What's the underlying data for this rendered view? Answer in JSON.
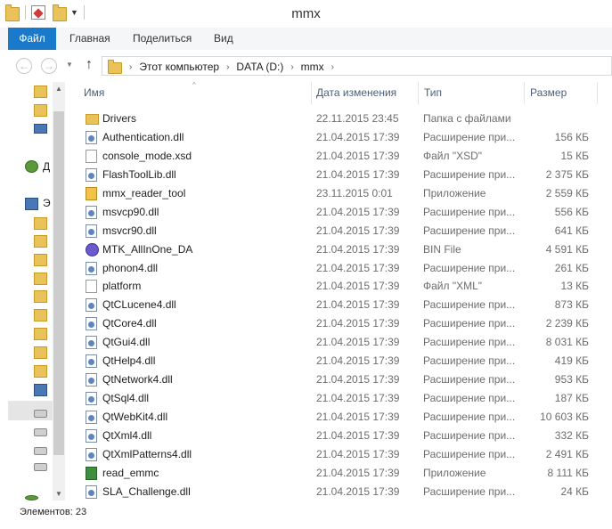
{
  "window": {
    "title": "mmx"
  },
  "ribbon": {
    "tabs": [
      "Файл",
      "Главная",
      "Поделиться",
      "Вид"
    ]
  },
  "address": {
    "crumbs": [
      "Этот компьютер",
      "DATA (D:)",
      "mmx"
    ]
  },
  "nav_pane": {
    "partial_labels": [
      "Д",
      "Э"
    ]
  },
  "columns": {
    "name": "Имя",
    "date": "Дата изменения",
    "type": "Тип",
    "size": "Размер"
  },
  "files": [
    {
      "name": "Drivers",
      "date": "22.11.2015 23:45",
      "type": "Папка с файлами",
      "size": "",
      "icon": "folder"
    },
    {
      "name": "Authentication.dll",
      "date": "21.04.2015 17:39",
      "type": "Расширение при...",
      "size": "156 КБ",
      "icon": "dll"
    },
    {
      "name": "console_mode.xsd",
      "date": "21.04.2015 17:39",
      "type": "Файл \"XSD\"",
      "size": "15 КБ",
      "icon": "doc"
    },
    {
      "name": "FlashToolLib.dll",
      "date": "21.04.2015 17:39",
      "type": "Расширение при...",
      "size": "2 375 КБ",
      "icon": "dll"
    },
    {
      "name": "mmx_reader_tool",
      "date": "23.11.2015 0:01",
      "type": "Приложение",
      "size": "2 559 КБ",
      "icon": "exe1"
    },
    {
      "name": "msvcp90.dll",
      "date": "21.04.2015 17:39",
      "type": "Расширение при...",
      "size": "556 КБ",
      "icon": "dll"
    },
    {
      "name": "msvcr90.dll",
      "date": "21.04.2015 17:39",
      "type": "Расширение при...",
      "size": "641 КБ",
      "icon": "dll"
    },
    {
      "name": "MTK_AllInOne_DA",
      "date": "21.04.2015 17:39",
      "type": "BIN File",
      "size": "4 591 КБ",
      "icon": "bin"
    },
    {
      "name": "phonon4.dll",
      "date": "21.04.2015 17:39",
      "type": "Расширение при...",
      "size": "261 КБ",
      "icon": "dll"
    },
    {
      "name": "platform",
      "date": "21.04.2015 17:39",
      "type": "Файл \"XML\"",
      "size": "13 КБ",
      "icon": "doc"
    },
    {
      "name": "QtCLucene4.dll",
      "date": "21.04.2015 17:39",
      "type": "Расширение при...",
      "size": "873 КБ",
      "icon": "dll"
    },
    {
      "name": "QtCore4.dll",
      "date": "21.04.2015 17:39",
      "type": "Расширение при...",
      "size": "2 239 КБ",
      "icon": "dll"
    },
    {
      "name": "QtGui4.dll",
      "date": "21.04.2015 17:39",
      "type": "Расширение при...",
      "size": "8 031 КБ",
      "icon": "dll"
    },
    {
      "name": "QtHelp4.dll",
      "date": "21.04.2015 17:39",
      "type": "Расширение при...",
      "size": "419 КБ",
      "icon": "dll"
    },
    {
      "name": "QtNetwork4.dll",
      "date": "21.04.2015 17:39",
      "type": "Расширение при...",
      "size": "953 КБ",
      "icon": "dll"
    },
    {
      "name": "QtSql4.dll",
      "date": "21.04.2015 17:39",
      "type": "Расширение при...",
      "size": "187 КБ",
      "icon": "dll"
    },
    {
      "name": "QtWebKit4.dll",
      "date": "21.04.2015 17:39",
      "type": "Расширение при...",
      "size": "10 603 КБ",
      "icon": "dll"
    },
    {
      "name": "QtXml4.dll",
      "date": "21.04.2015 17:39",
      "type": "Расширение при...",
      "size": "332 КБ",
      "icon": "dll"
    },
    {
      "name": "QtXmlPatterns4.dll",
      "date": "21.04.2015 17:39",
      "type": "Расширение при...",
      "size": "2 491 КБ",
      "icon": "dll"
    },
    {
      "name": "read_emmc",
      "date": "21.04.2015 17:39",
      "type": "Приложение",
      "size": "8 111 КБ",
      "icon": "exe2"
    },
    {
      "name": "SLA_Challenge.dll",
      "date": "21.04.2015 17:39",
      "type": "Расширение при...",
      "size": "24 КБ",
      "icon": "dll"
    }
  ],
  "status": {
    "items_count": "Элементов: 23"
  }
}
